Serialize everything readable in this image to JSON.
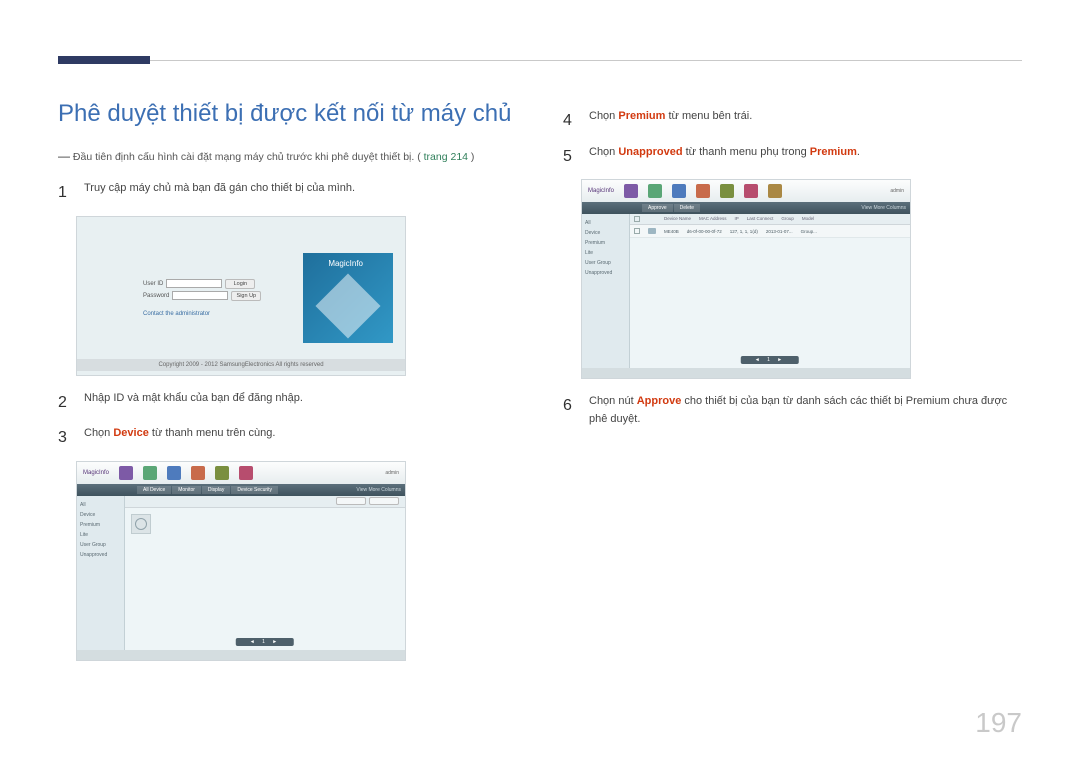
{
  "page_number": "197",
  "heading": "Phê duyệt thiết bị được kết nối từ máy chủ",
  "note_prefix": "―",
  "note": "Đầu tiên định cấu hình cài đặt mạng máy chủ trước khi phê duyệt thiết bị. (",
  "note_link": "trang 214",
  "note_suffix": ")",
  "steps": {
    "s1": "Truy cập máy chủ mà bạn đã gán cho thiết bị của mình.",
    "s2": "Nhập ID và mật khẩu của bạn để đăng nhập.",
    "s3_pre": "Chọn ",
    "s3_hl": "Device",
    "s3_post": " từ thanh menu trên cùng.",
    "s4_pre": "Chọn ",
    "s4_hl": "Premium",
    "s4_post": " từ menu bên trái.",
    "s5_pre": "Chọn ",
    "s5_hl": "Unapproved",
    "s5_mid": " từ thanh menu phụ trong ",
    "s5_hl2": "Premium",
    "s5_post": ".",
    "s6_pre": "Chọn nút ",
    "s6_hl": "Approve",
    "s6_post": " cho thiết bị của bạn từ danh sách các thiết bị Premium chưa được phê duyệt."
  },
  "login": {
    "brand": "MagicInfo",
    "userid_label": "User ID",
    "password_label": "Password",
    "login_btn": "Login",
    "signup_btn": "Sign Up",
    "contact": "Contact the administrator",
    "copyright": "Copyright 2009 - 2012 SamsungElectronics All rights reserved"
  },
  "app": {
    "logo": "MagicInfo",
    "user_label": "admin",
    "sidebar": [
      "All",
      "Device",
      "Premium",
      "Lite",
      "User Group",
      "Unapproved"
    ],
    "sub_tabs": [
      "All Device",
      "Monitor",
      "Display",
      "Device Security"
    ],
    "sub_right": "View More Columns",
    "pager": "◄  1  ►",
    "list_headers": [
      "",
      "",
      "Device Name",
      "MAC Address",
      "IP",
      "Last Connect",
      "Group",
      "Model"
    ],
    "list_row": [
      "",
      "",
      "ME40B",
      "d6-0f-00-00-0f-72",
      "127, 1, 1, 1(d)",
      "2013-01-07...",
      "Group...",
      ""
    ]
  }
}
